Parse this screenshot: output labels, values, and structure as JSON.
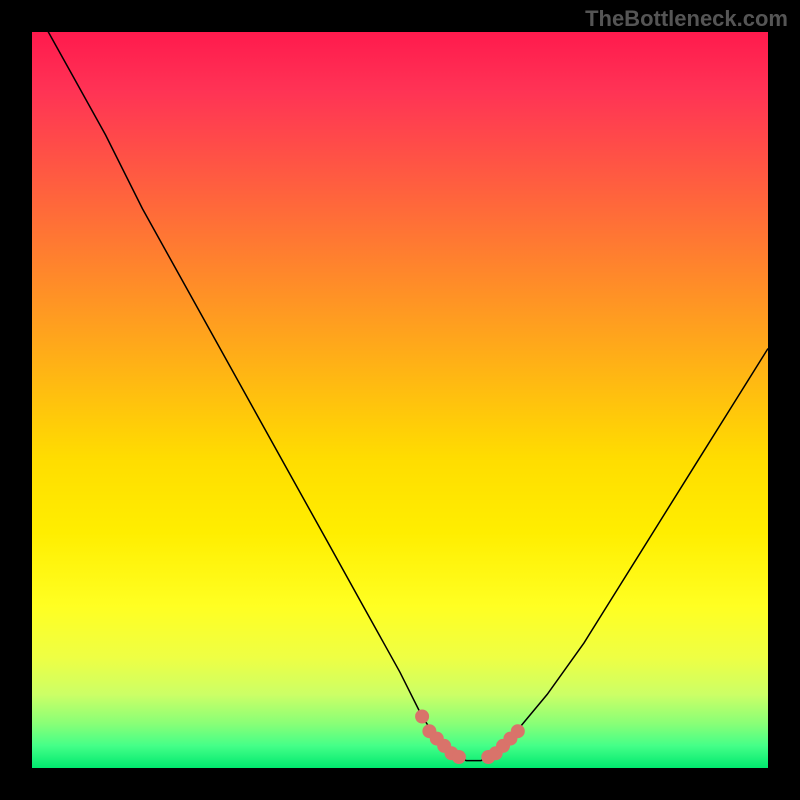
{
  "watermark": "TheBottleneck.com",
  "chart_data": {
    "type": "line",
    "title": "",
    "xlabel": "",
    "ylabel": "",
    "xlim": [
      0,
      100
    ],
    "ylim": [
      0,
      100
    ],
    "grid": false,
    "background": "red-yellow-green vertical gradient",
    "series": [
      {
        "name": "bottleneck-curve",
        "x": [
          0,
          5,
          10,
          15,
          20,
          25,
          30,
          35,
          40,
          45,
          50,
          53,
          55,
          57,
          59,
          61,
          63,
          65,
          70,
          75,
          80,
          85,
          90,
          95,
          100
        ],
        "y": [
          104,
          95,
          86,
          76,
          67,
          58,
          49,
          40,
          31,
          22,
          13,
          7,
          4,
          2,
          1,
          1,
          2,
          4,
          10,
          17,
          25,
          33,
          41,
          49,
          57
        ]
      }
    ],
    "markers": [
      {
        "x": 53,
        "y": 7
      },
      {
        "x": 54,
        "y": 5
      },
      {
        "x": 55,
        "y": 4
      },
      {
        "x": 56,
        "y": 3
      },
      {
        "x": 57,
        "y": 2
      },
      {
        "x": 58,
        "y": 1.5
      },
      {
        "x": 62,
        "y": 1.5
      },
      {
        "x": 63,
        "y": 2
      },
      {
        "x": 64,
        "y": 3
      },
      {
        "x": 65,
        "y": 4
      },
      {
        "x": 66,
        "y": 5
      }
    ],
    "marker_color": "#d9736a"
  }
}
